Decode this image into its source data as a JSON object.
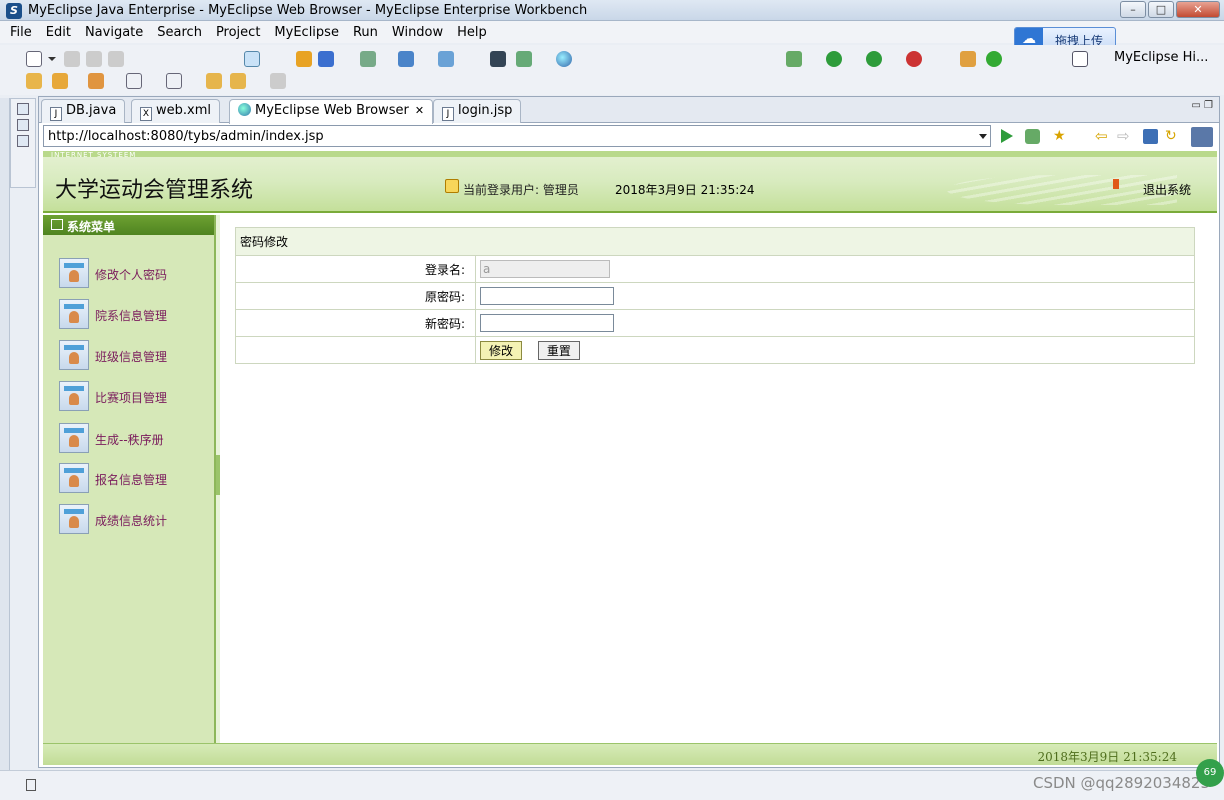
{
  "window": {
    "title": "MyEclipse Java Enterprise - MyEclipse Web Browser - MyEclipse Enterprise Workbench",
    "min": "–",
    "max": "□",
    "close": "✕"
  },
  "menu": {
    "items": [
      "File",
      "Edit",
      "Navigate",
      "Search",
      "Project",
      "MyEclipse",
      "Run",
      "Window",
      "Help"
    ]
  },
  "toolbar": {
    "cloud_upload": "拖拽上传",
    "perspective": "MyEclipse Hi..."
  },
  "tabs": [
    {
      "label": "DB.java",
      "active": false
    },
    {
      "label": "web.xml",
      "active": false
    },
    {
      "label": "MyEclipse Web Browser",
      "active": true
    },
    {
      "label": "login.jsp",
      "active": false
    }
  ],
  "browser": {
    "url": "http://localhost:8080/tybs/admin/index.jsp"
  },
  "page": {
    "header": {
      "subtitle": "INTERNET SYSTEEM",
      "title": "大学运动会管理系统",
      "user": "当前登录用户: 管理员",
      "datetime": "2018年3月9日  21:35:24",
      "logout": "退出系统"
    },
    "sidebar": {
      "heading": "系统菜单",
      "items": [
        {
          "label": "修改个人密码"
        },
        {
          "label": "院系信息管理"
        },
        {
          "label": "班级信息管理"
        },
        {
          "label": "比赛项目管理"
        },
        {
          "label": "生成--秩序册"
        },
        {
          "label": "报名信息管理"
        },
        {
          "label": "成绩信息统计"
        }
      ]
    },
    "form": {
      "caption": "密码修改",
      "login_label": "登录名:",
      "login_value": "a",
      "old_label": "原密码:",
      "old_value": "",
      "new_label": "新密码:",
      "new_value": "",
      "submit": "修改",
      "reset": "重置"
    },
    "footer": {
      "datetime": "2018年3月9日  21:35:24"
    }
  },
  "status": {
    "watermark": "CSDN @qq2892034823",
    "badge": "69"
  }
}
